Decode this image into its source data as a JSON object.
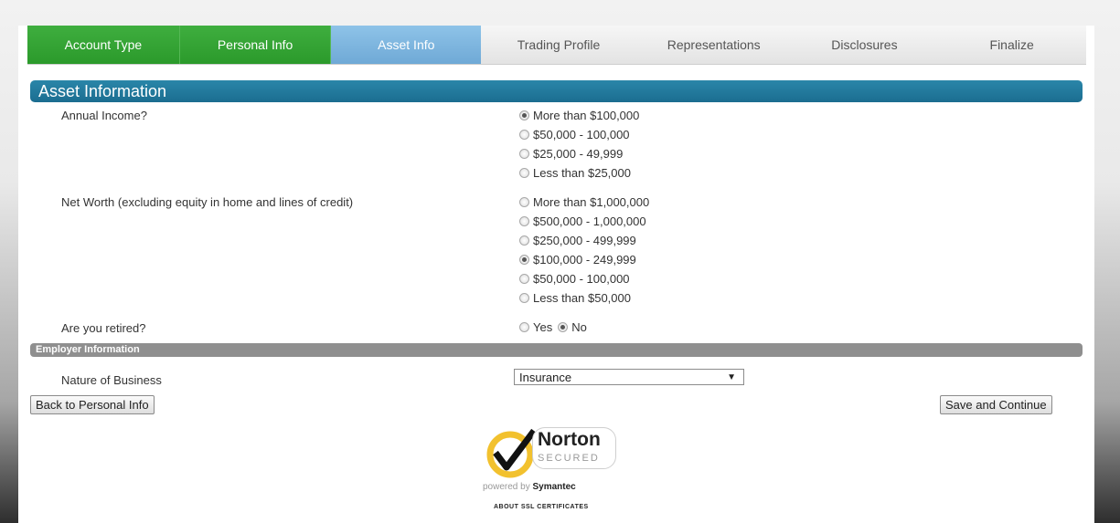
{
  "tabs": [
    {
      "label": "Account Type",
      "state": "done"
    },
    {
      "label": "Personal Info",
      "state": "done"
    },
    {
      "label": "Asset Info",
      "state": "active"
    },
    {
      "label": "Trading Profile",
      "state": "upcoming"
    },
    {
      "label": "Representations",
      "state": "upcoming"
    },
    {
      "label": "Disclosures",
      "state": "upcoming"
    },
    {
      "label": "Finalize",
      "state": "upcoming"
    }
  ],
  "section_title": "Asset Information",
  "annual_income": {
    "label": "Annual Income?",
    "options": [
      "More than $100,000",
      "$50,000 - 100,000",
      "$25,000 - 49,999",
      "Less than $25,000"
    ],
    "selected": "More than $100,000"
  },
  "net_worth": {
    "label": "Net Worth (excluding equity in home and lines of credit)",
    "options": [
      "More than $1,000,000",
      "$500,000 - 1,000,000",
      "$250,000 - 499,999",
      "$100,000 - 249,999",
      "$50,000 - 100,000",
      "Less than $50,000"
    ],
    "selected": "$100,000 - 249,999"
  },
  "retired": {
    "label": "Are you retired?",
    "options": [
      "Yes",
      "No"
    ],
    "selected": "No"
  },
  "employer_section_title": "Employer Information",
  "nature_of_business": {
    "label": "Nature of Business",
    "value": "Insurance"
  },
  "buttons": {
    "back": "Back to Personal Info",
    "save": "Save and Continue"
  },
  "norton": {
    "title": "Norton",
    "secured": "SECURED",
    "powered_prefix": "powered by ",
    "powered_brand": "Symantec",
    "ssl_link": "ABOUT SSL CERTIFICATES"
  },
  "colors": {
    "tab_done": "#2e9e2e",
    "tab_active": "#7fb6df",
    "section_bar": "#217aa0",
    "sub_bar": "#8f8f8f",
    "norton_yellow": "#f2c12e"
  }
}
